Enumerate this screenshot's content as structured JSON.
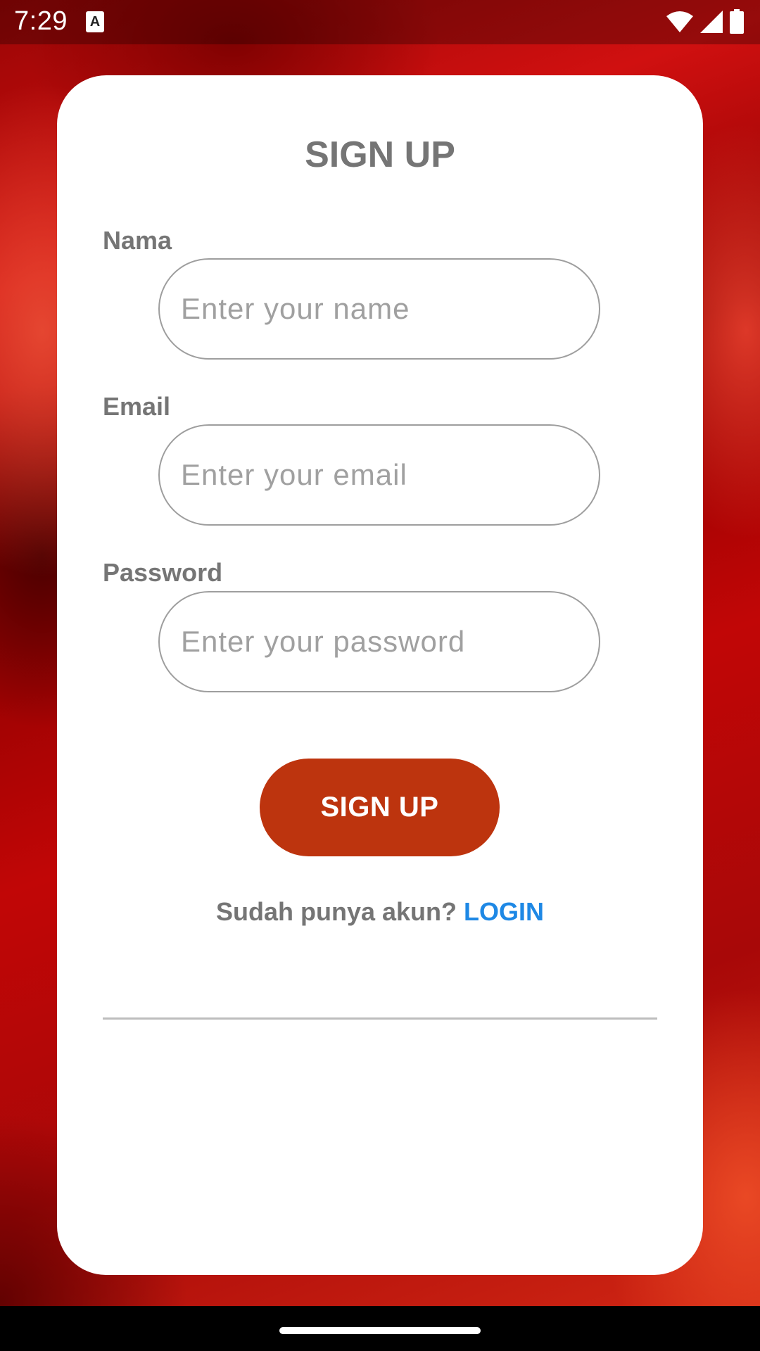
{
  "status_bar": {
    "time": "7:29",
    "notification_icon": "A",
    "icons": [
      "wifi-icon",
      "signal-icon",
      "battery-icon"
    ]
  },
  "signup_form": {
    "title": "SIGN UP",
    "fields": [
      {
        "label": "Nama",
        "placeholder": "Enter your name",
        "value": ""
      },
      {
        "label": "Email",
        "placeholder": "Enter your email",
        "value": ""
      },
      {
        "label": "Password",
        "placeholder": "Enter your password",
        "value": ""
      }
    ],
    "submit_label": "SIGN UP",
    "login_prompt": "Sudah punya akun?",
    "login_link": "LOGIN"
  },
  "colors": {
    "button": "#bd340e",
    "link": "#1e88e5",
    "label": "#757575",
    "field_border": "#9e9e9e"
  }
}
